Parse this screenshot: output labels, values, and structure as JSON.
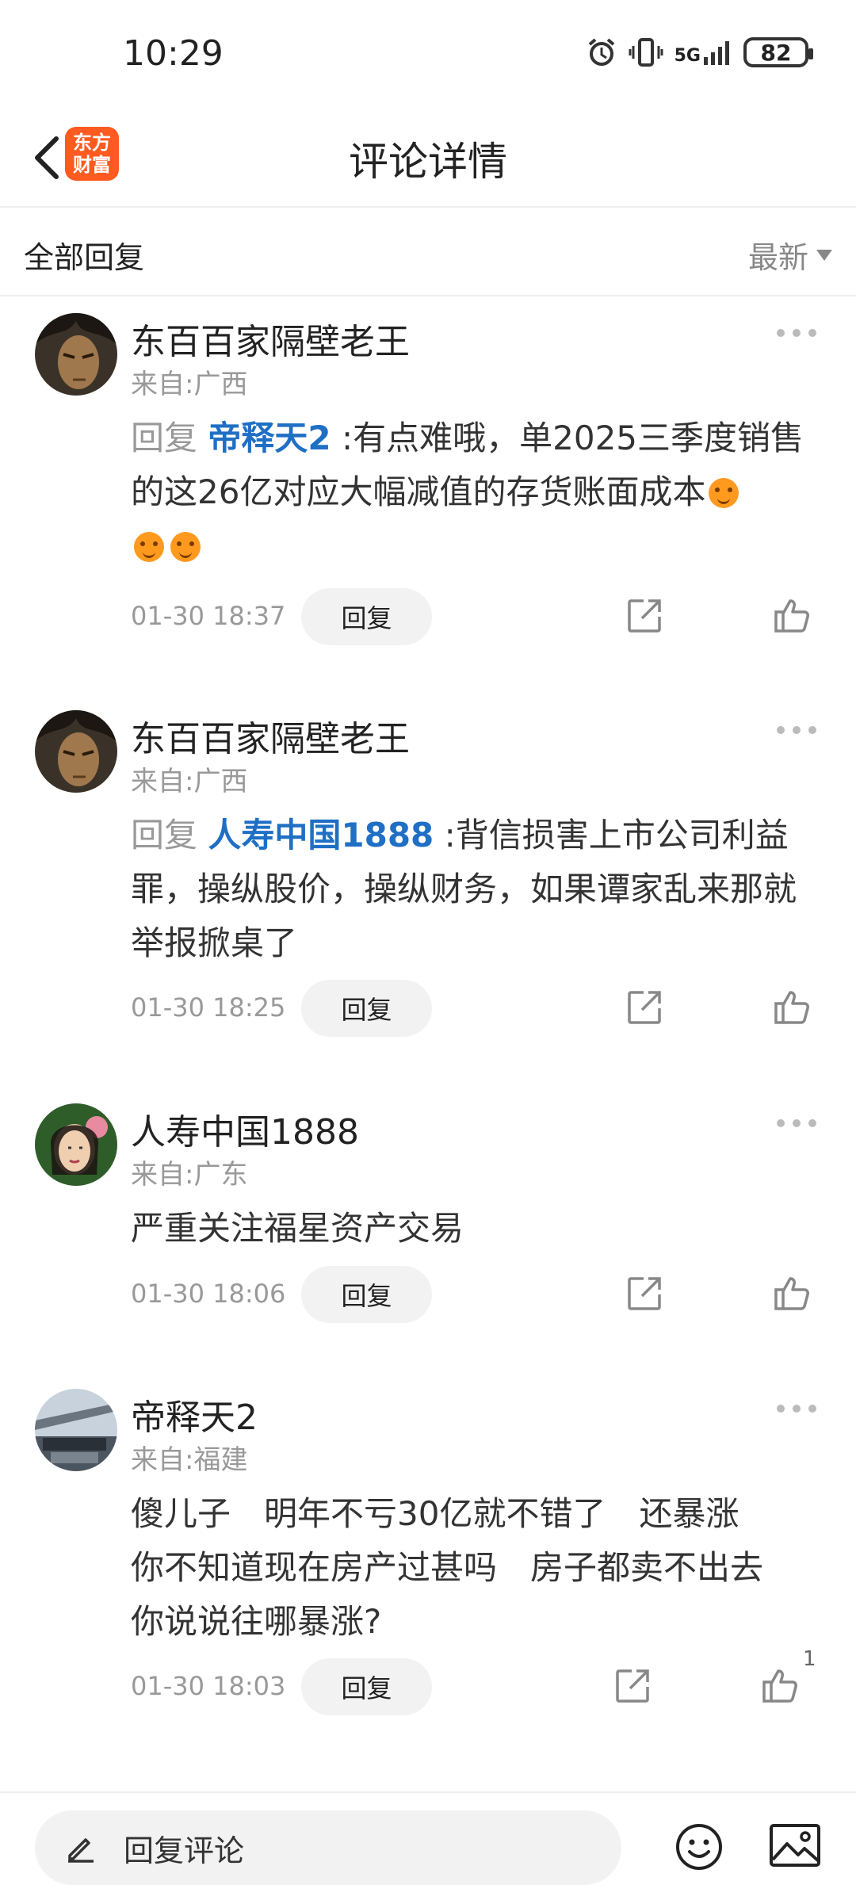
{
  "status": {
    "time": "10:29",
    "battery": "82",
    "network": "5G"
  },
  "header": {
    "title": "评论详情",
    "logo_text": [
      "东方",
      "财富"
    ]
  },
  "section": {
    "title": "全部回复",
    "sort_label": "最新"
  },
  "comments": [
    {
      "user": "东百百家隔壁老王",
      "location": "来自:广西",
      "reply_prefix": "回复",
      "mention": "帝释天2",
      "text": ":有点难哦，单2025三季度销售的这26亿对应大幅减值的存货账面成本",
      "time": "01-30 18:37",
      "reply_label": "回复"
    },
    {
      "user": "东百百家隔壁老王",
      "location": "来自:广西",
      "reply_prefix": "回复",
      "mention": "人寿中国1888",
      "text": ":背信损害上市公司利益罪，操纵股价，操纵财务，如果谭家乱来那就举报掀桌了",
      "time": "01-30 18:25",
      "reply_label": "回复"
    },
    {
      "user": "人寿中国1888",
      "location": "来自:广东",
      "text": "严重关注福星资产交易",
      "time": "01-30 18:06",
      "reply_label": "回复"
    },
    {
      "user": "帝释天2",
      "location": "来自:福建",
      "lines": [
        "傻儿子　明年不亏30亿就不错了　还暴涨",
        "你不知道现在房产过甚吗　房子都卖不出去",
        "你说说往哪暴涨?"
      ],
      "time": "01-30 18:03",
      "reply_label": "回复",
      "likes": "1"
    }
  ],
  "footer": {
    "input_label": "回复评论"
  },
  "colors": {
    "accent": "#ff5a1f",
    "mention": "#1f6fc5",
    "muted": "#999999"
  }
}
